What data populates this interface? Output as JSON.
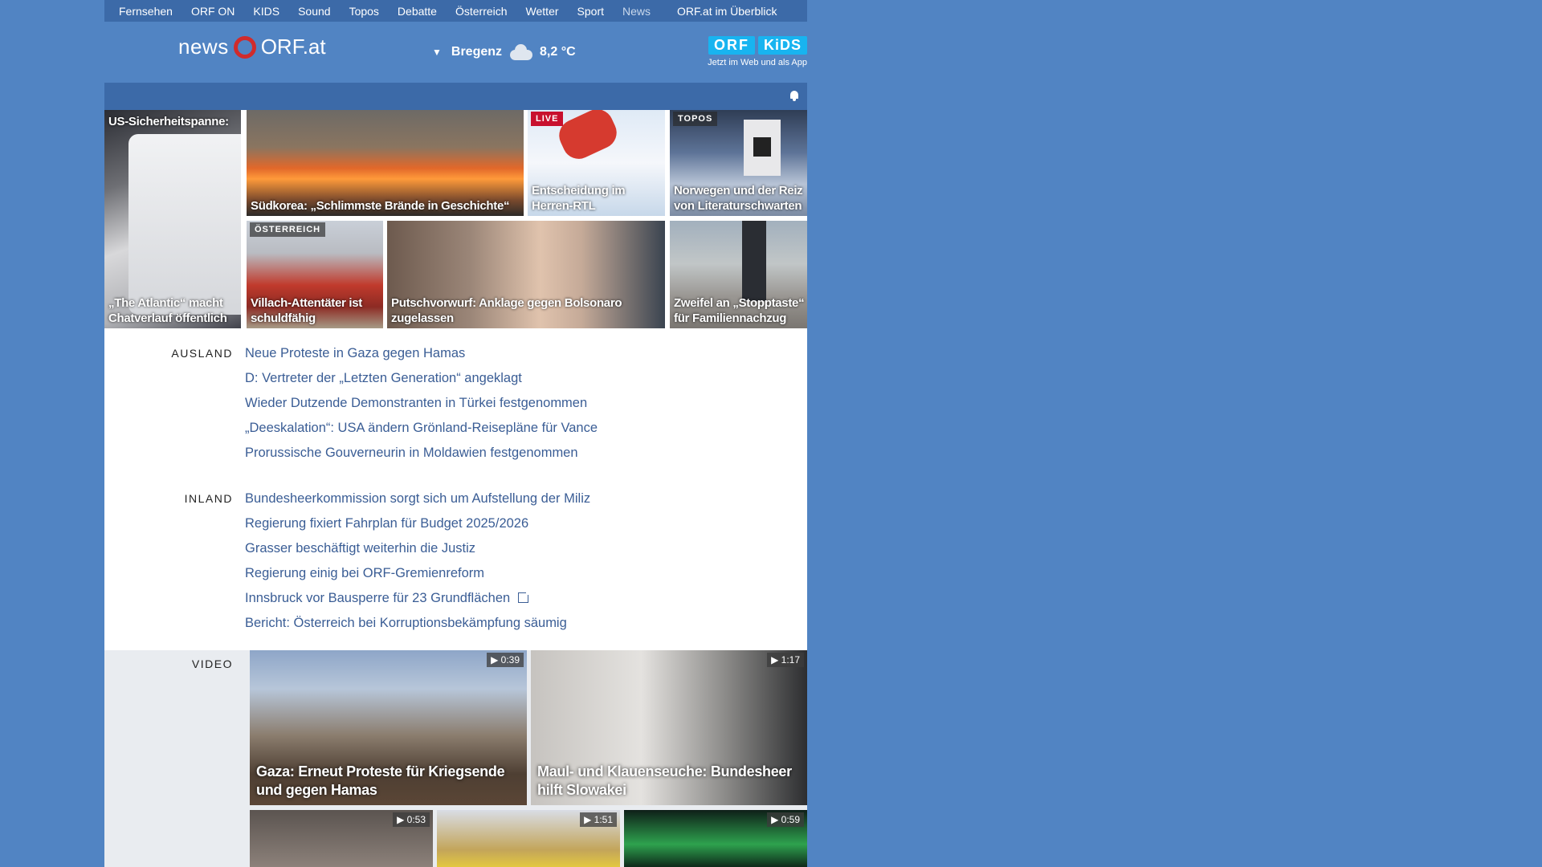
{
  "topnav": {
    "items": [
      "Fernsehen",
      "ORF ON",
      "KIDS",
      "Sound",
      "Topos",
      "Debatte",
      "Österreich",
      "Wetter",
      "Sport",
      "News"
    ],
    "overview": "ORF.at im Überblick"
  },
  "header": {
    "logo_news": "news",
    "logo_orf": "ORF.at",
    "weather_city": "Bregenz",
    "weather_temp": "8,2 °C",
    "weather_icon": "cloud-icon",
    "kids_badge_orf": "ORF",
    "kids_badge_kids": "KiDS",
    "kids_sub": "Jetzt im Web und als App"
  },
  "teasers": {
    "t1_top": "US-Sicherheitspanne:",
    "t1_caption": "„The Atlantic“ macht Chatverlauf öffentlich",
    "t2_caption": "Südkorea: „Schlimmste Brände in Geschichte“",
    "t3_tag": "LIVE",
    "t3_caption": "Entscheidung im Herren-RTL",
    "t4_tag": "TOPOS",
    "t4_caption": "Norwegen und der Reiz von Literaturschwarten",
    "t5_tag": "ÖSTERREICH",
    "t5_caption": "Villach-Attentäter ist schuldfähig",
    "t6_caption": "Putschvorwurf: Anklage gegen Bolsonaro zugelassen",
    "t7_caption": "Zweifel an „Stopptaste“ für Familiennachzug"
  },
  "ausland": {
    "label": "AUSLAND",
    "items": [
      "Neue Proteste in Gaza gegen Hamas",
      "D: Vertreter der „Letzten Generation“ angeklagt",
      "Wieder Dutzende Demonstranten in Türkei festgenommen",
      "„Deeskalation“: USA ändern Grönland-Reisepläne für Vance",
      "Prorussische Gouverneurin in Moldawien festgenommen"
    ]
  },
  "inland": {
    "label": "INLAND",
    "items": [
      "Bundesheerkommission sorgt sich um Aufstellung der Miliz",
      "Regierung fixiert Fahrplan für Budget 2025/2026",
      "Grasser beschäftigt weiterhin die Justiz",
      "Regierung einig bei ORF-Gremienreform",
      "Innsbruck vor Bausperre für 23 Grundflächen",
      "Bericht: Österreich bei Korruptionsbekämpfung säumig"
    ]
  },
  "video": {
    "label": "VIDEO",
    "v1_duration": "▶ 0:39",
    "v1_caption": "Gaza: Erneut Proteste für Kriegsende und gegen Hamas",
    "v2_duration": "▶ 1:17",
    "v2_caption": "Maul- und Klauenseuche: Bundesheer hilft Slowakei",
    "v3_duration": "▶ 0:53",
    "v4_duration": "▶ 1:51",
    "v5_duration": "▶ 0:59"
  }
}
